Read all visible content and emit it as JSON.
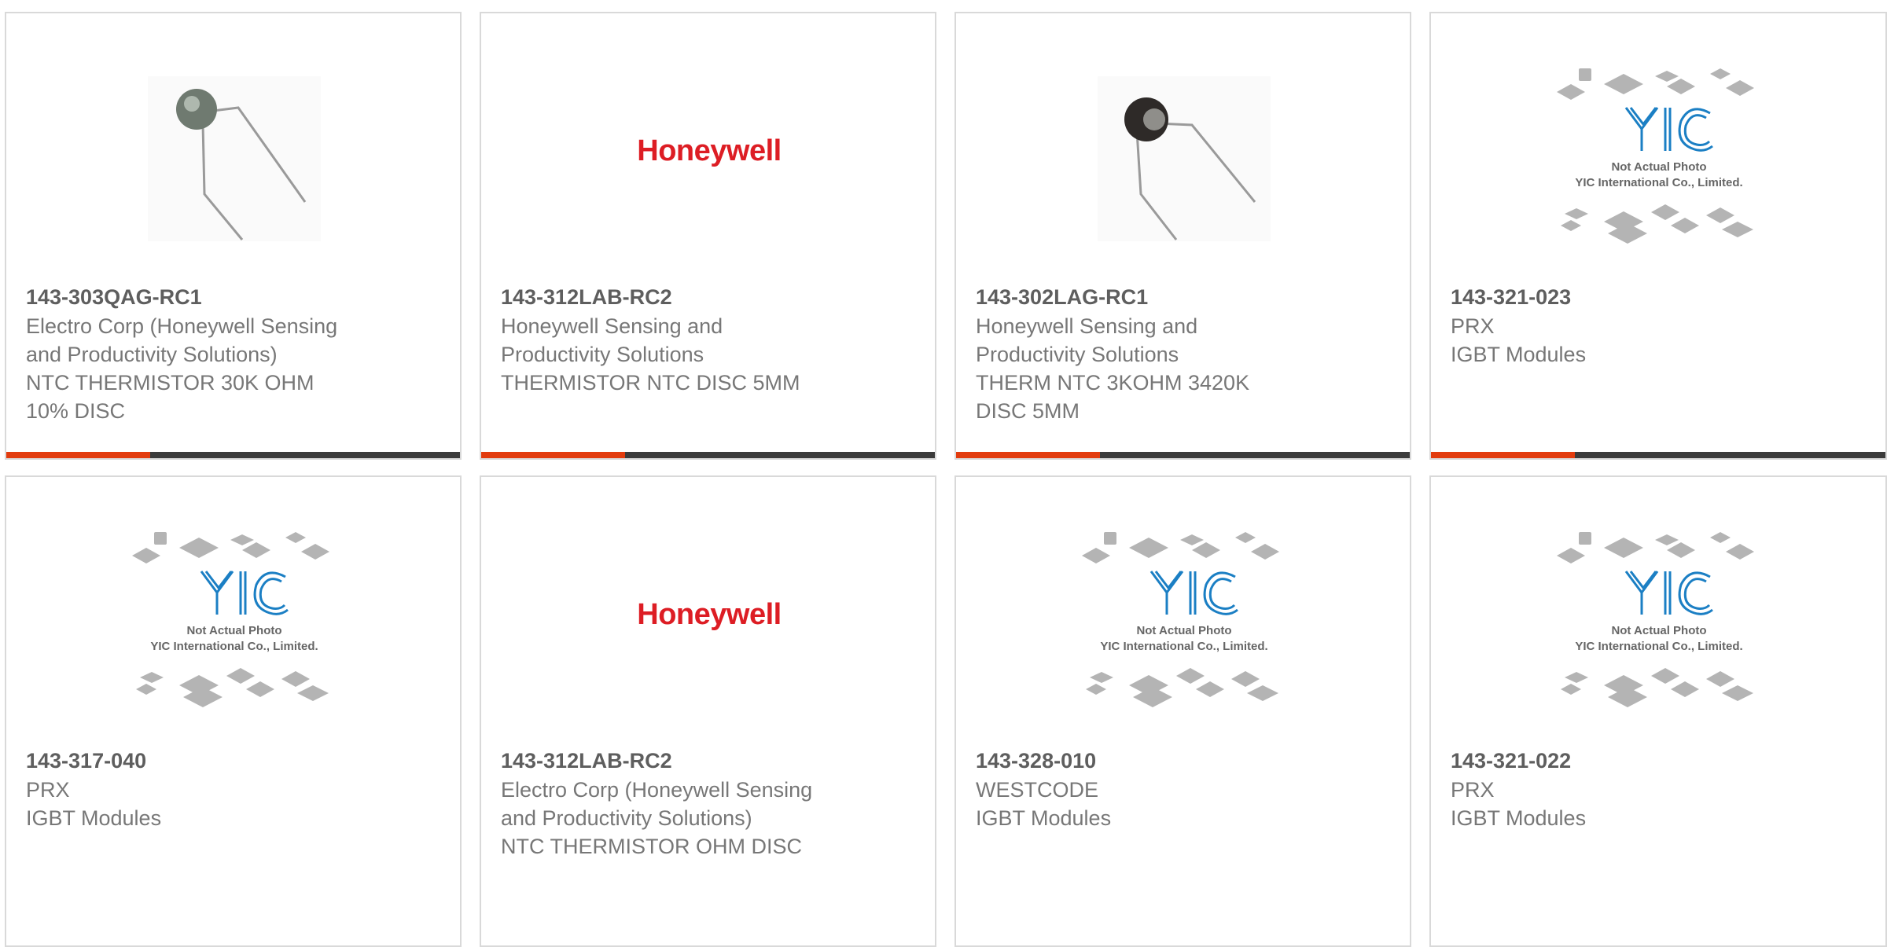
{
  "products": [
    {
      "part": "143-303QAG-RC1",
      "lines": [
        "Electro Corp (Honeywell Sensing",
        "and Productivity Solutions)",
        "NTC THERMISTOR 30K OHM",
        "10% DISC"
      ],
      "image": "thermistor-photo-green"
    },
    {
      "part": "143-312LAB-RC2",
      "lines": [
        "Honeywell Sensing and",
        "Productivity Solutions",
        "THERMISTOR NTC DISC 5MM"
      ],
      "image": "honeywell-logo"
    },
    {
      "part": "143-302LAG-RC1",
      "lines": [
        "Honeywell Sensing and",
        "Productivity Solutions",
        "THERM NTC 3KOHM 3420K",
        "DISC 5MM"
      ],
      "image": "thermistor-photo-black"
    },
    {
      "part": "143-321-023",
      "lines": [
        "PRX",
        "IGBT Modules"
      ],
      "image": "yic-placeholder"
    },
    {
      "part": "143-317-040",
      "lines": [
        "PRX",
        "IGBT Modules"
      ],
      "image": "yic-placeholder"
    },
    {
      "part": "143-312LAB-RC2",
      "lines": [
        "Electro Corp (Honeywell Sensing",
        "and Productivity Solutions)",
        "NTC THERMISTOR OHM DISC"
      ],
      "image": "honeywell-logo"
    },
    {
      "part": "143-328-010",
      "lines": [
        "WESTCODE",
        "IGBT Modules"
      ],
      "image": "yic-placeholder"
    },
    {
      "part": "143-321-022",
      "lines": [
        "PRX",
        "IGBT Modules"
      ],
      "image": "yic-placeholder"
    }
  ],
  "logos": {
    "honeywell": "Honeywell",
    "yic_line1": "Not Actual Photo",
    "yic_line2": "YIC International Co., Limited.",
    "yic_mark": "YIC"
  },
  "colors": {
    "accent": "#e23c0e",
    "bar": "#3b3b3b",
    "honeywell_red": "#dd1d24",
    "yic_blue": "#1b7fc4"
  }
}
